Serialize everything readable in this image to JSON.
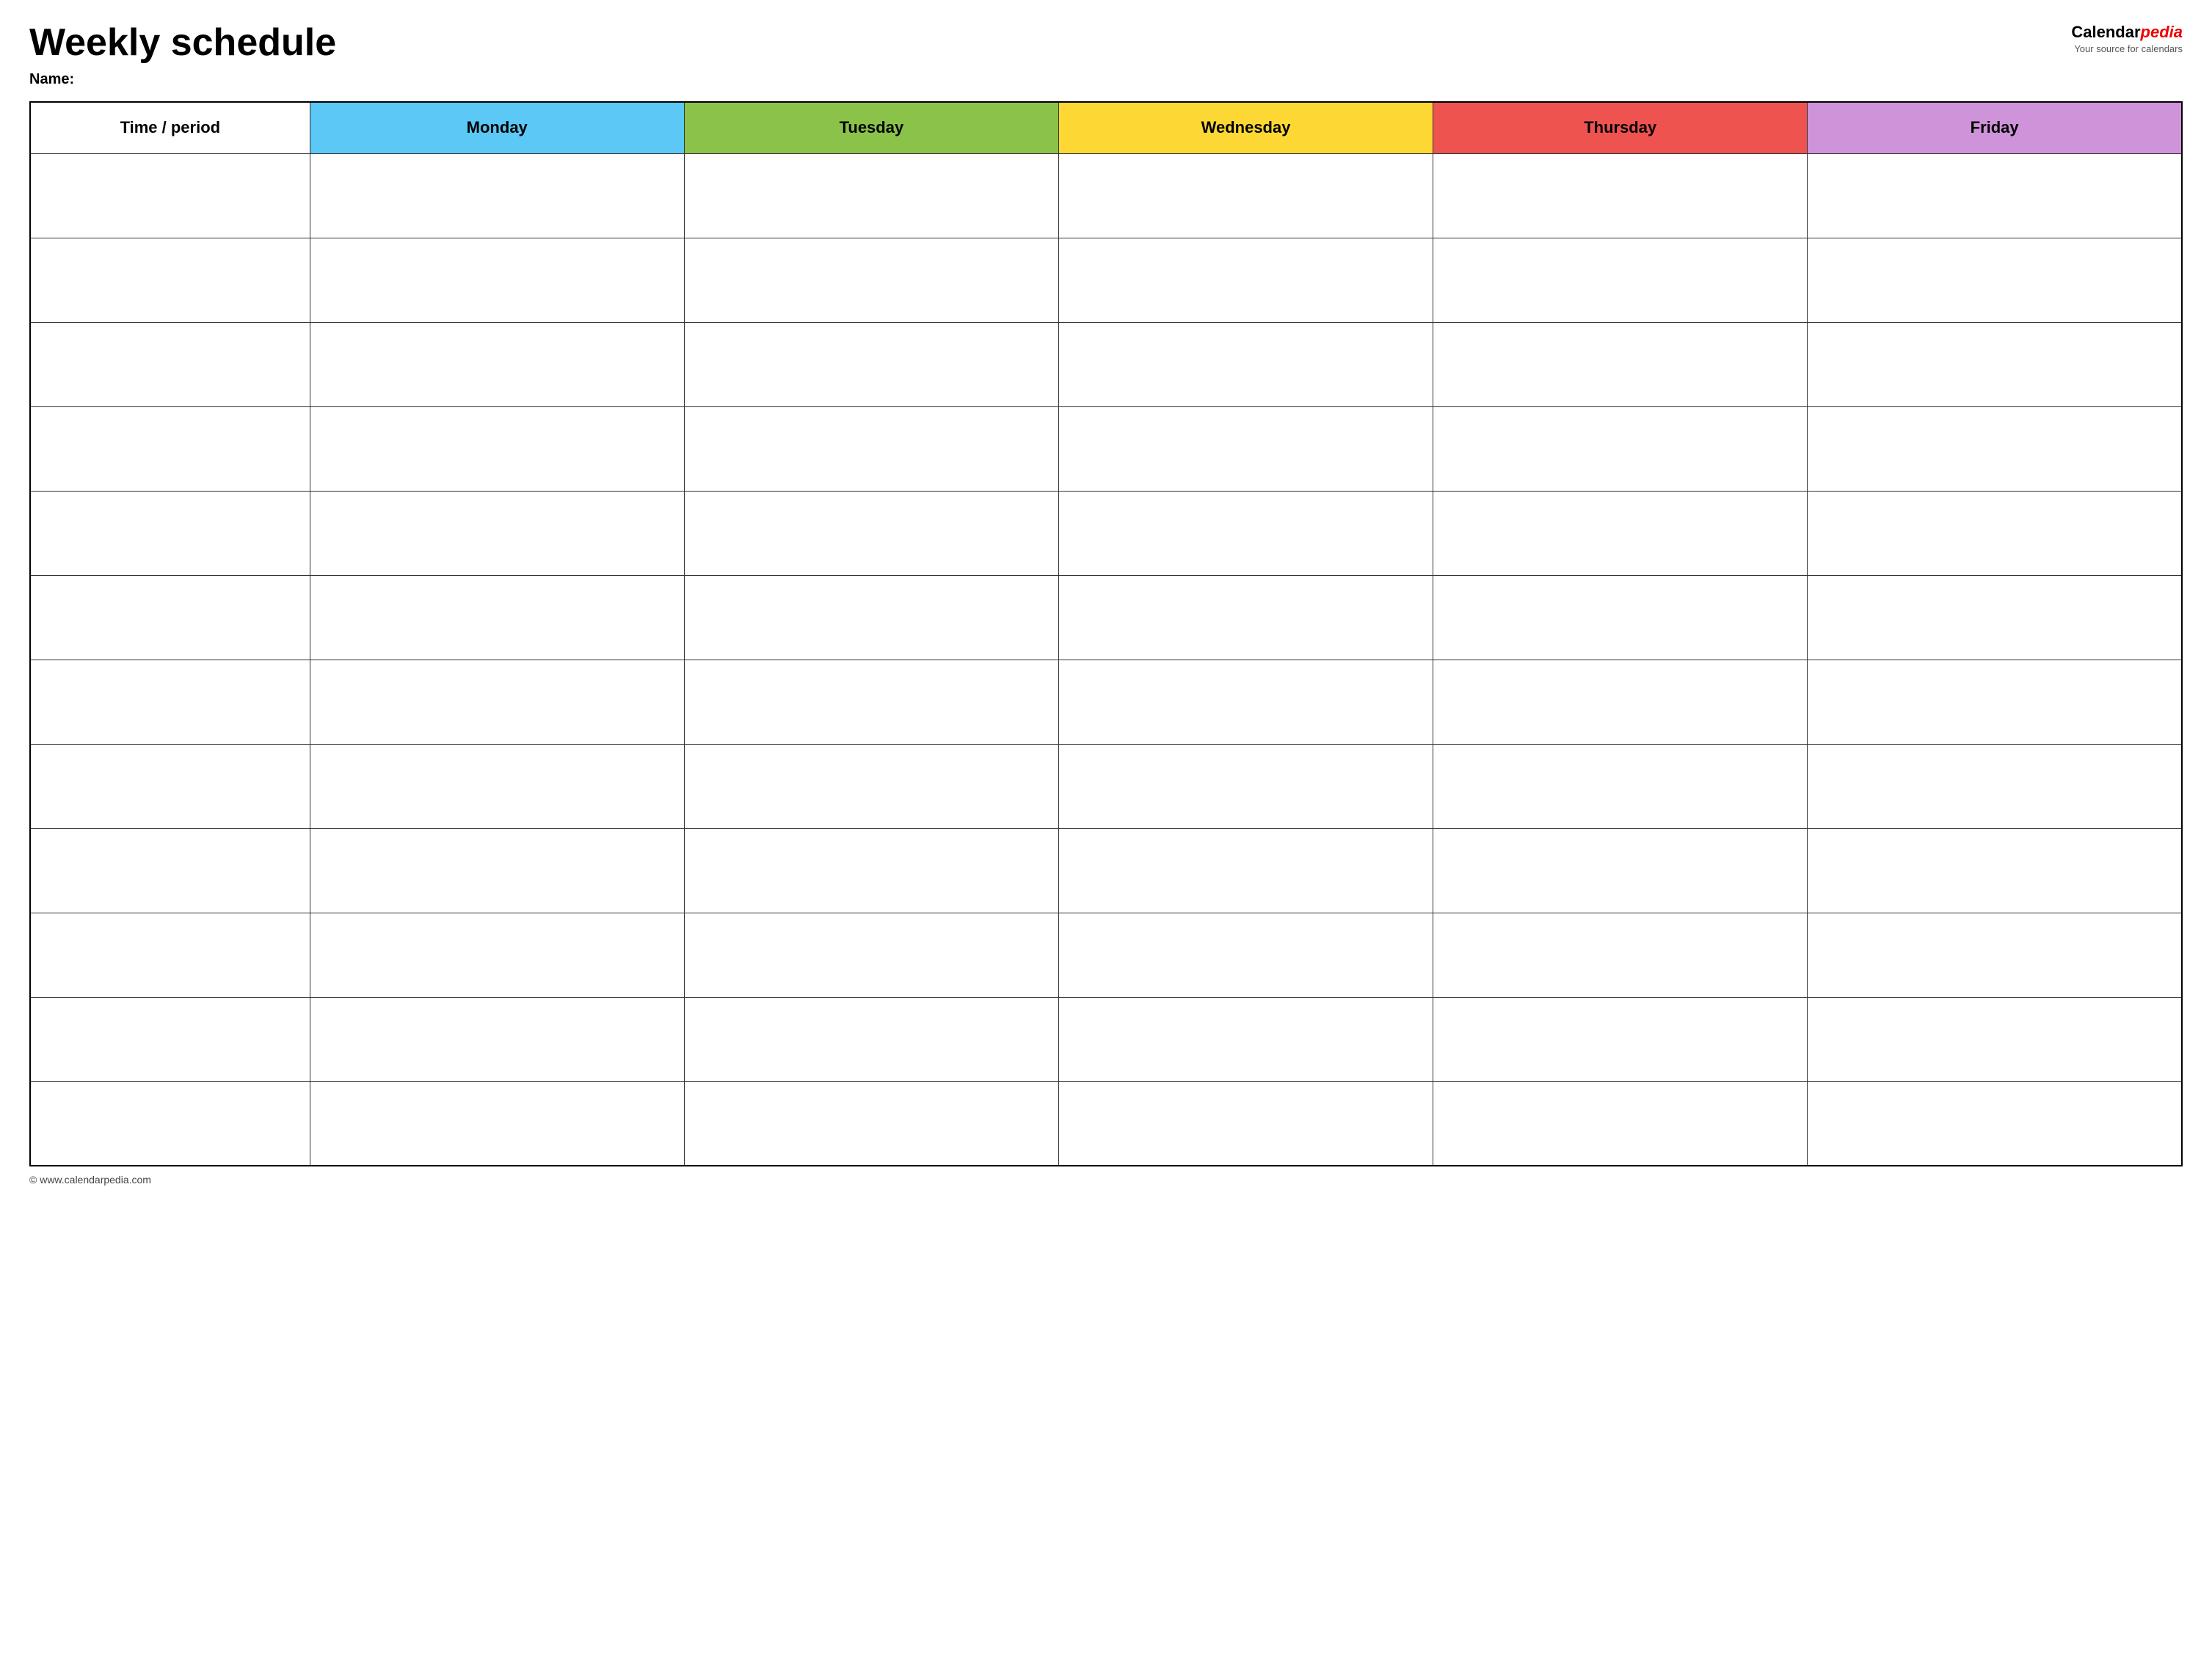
{
  "header": {
    "title": "Weekly schedule",
    "name_label": "Name:",
    "logo_calendar": "Calendar",
    "logo_pedia": "pedia",
    "logo_tagline": "Your source for calendars"
  },
  "table": {
    "columns": [
      {
        "key": "time",
        "label": "Time / period",
        "color": "#ffffff"
      },
      {
        "key": "monday",
        "label": "Monday",
        "color": "#5bc8f5"
      },
      {
        "key": "tuesday",
        "label": "Tuesday",
        "color": "#8bc34a"
      },
      {
        "key": "wednesday",
        "label": "Wednesday",
        "color": "#fdd835"
      },
      {
        "key": "thursday",
        "label": "Thursday",
        "color": "#ef5350"
      },
      {
        "key": "friday",
        "label": "Friday",
        "color": "#ce93d8"
      }
    ],
    "row_count": 12
  },
  "footer": {
    "copyright": "© www.calendarpedia.com"
  }
}
